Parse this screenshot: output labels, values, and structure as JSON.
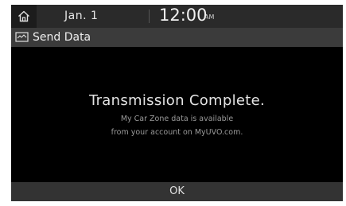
{
  "status_bar": {
    "home_icon": "home-icon",
    "date": "Jan. 1",
    "time": "12:00",
    "ampm": "AM"
  },
  "title_bar": {
    "icon": "send-data-icon",
    "title": "Send Data"
  },
  "message": {
    "heading": "Transmission Complete.",
    "line1": "My Car Zone data is available",
    "line2": "from your account on MyUVO.com."
  },
  "buttons": {
    "ok_label": "OK"
  },
  "colors": {
    "background": "#000000",
    "status_bar": "#2a2a2a",
    "title_bar": "#3b3b3b",
    "button": "#333333"
  }
}
